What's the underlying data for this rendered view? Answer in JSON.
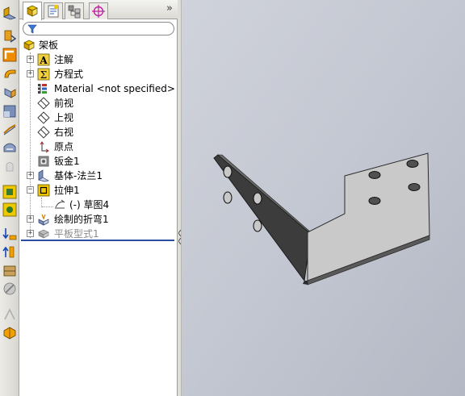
{
  "left_toolbar": {
    "tools": [
      "base-flange-icon",
      "convert-to-sheetmetal-icon",
      "edge-flange-icon",
      "miter-flange-icon",
      "hem-icon",
      "jog-icon",
      "sketched-bend-icon",
      "cross-break-icon",
      "lofted-bend-icon",
      "extrude-cut-icon",
      "simple-hole-icon",
      "unfold-icon",
      "fold-icon",
      "flatten-icon",
      "no-bends-icon",
      "rip-icon",
      "insert-bends-icon",
      "mirror-icon"
    ]
  },
  "feature_manager": {
    "tabs": [
      "featuremanager-tab",
      "propertymanager-tab",
      "configurationmanager-tab",
      "dimxpert-tab"
    ],
    "collapse_label": "»",
    "filter_placeholder": "",
    "root_label": "架板",
    "items": [
      {
        "label": "注解",
        "icon": "annotations-icon",
        "expandable": true
      },
      {
        "label": "方程式",
        "icon": "equations-icon",
        "expandable": true
      },
      {
        "label": "Material <not specified>",
        "icon": "material-icon",
        "expandable": false
      },
      {
        "label": "前视",
        "icon": "plane-icon",
        "expandable": false
      },
      {
        "label": "上视",
        "icon": "plane-icon",
        "expandable": false
      },
      {
        "label": "右视",
        "icon": "plane-icon",
        "expandable": false
      },
      {
        "label": "原点",
        "icon": "origin-icon",
        "expandable": false
      },
      {
        "label": "钣金1",
        "icon": "sheet-metal-icon",
        "expandable": false
      },
      {
        "label": "基体-法兰1",
        "icon": "base-flange-icon",
        "expandable": true
      },
      {
        "label": "拉伸1",
        "icon": "extrude-icon",
        "expandable": true,
        "expanded": true
      },
      {
        "label": "(-) 草图4",
        "icon": "sketch-icon",
        "expandable": false,
        "child": true
      },
      {
        "label": "绘制的折弯1",
        "icon": "sketched-bend-icon",
        "expandable": true
      },
      {
        "label": "平板型式1",
        "icon": "flat-pattern-icon",
        "expandable": true,
        "suppressed": true
      }
    ]
  },
  "colors": {
    "viewport_bg": "#c3c7d1",
    "part_face": "#c8c8c8",
    "part_dark": "#3a3a3a",
    "rollback_bar": "#2a4fa0",
    "accent_yellow": "#f0c800",
    "accent_orange": "#f08c00"
  }
}
